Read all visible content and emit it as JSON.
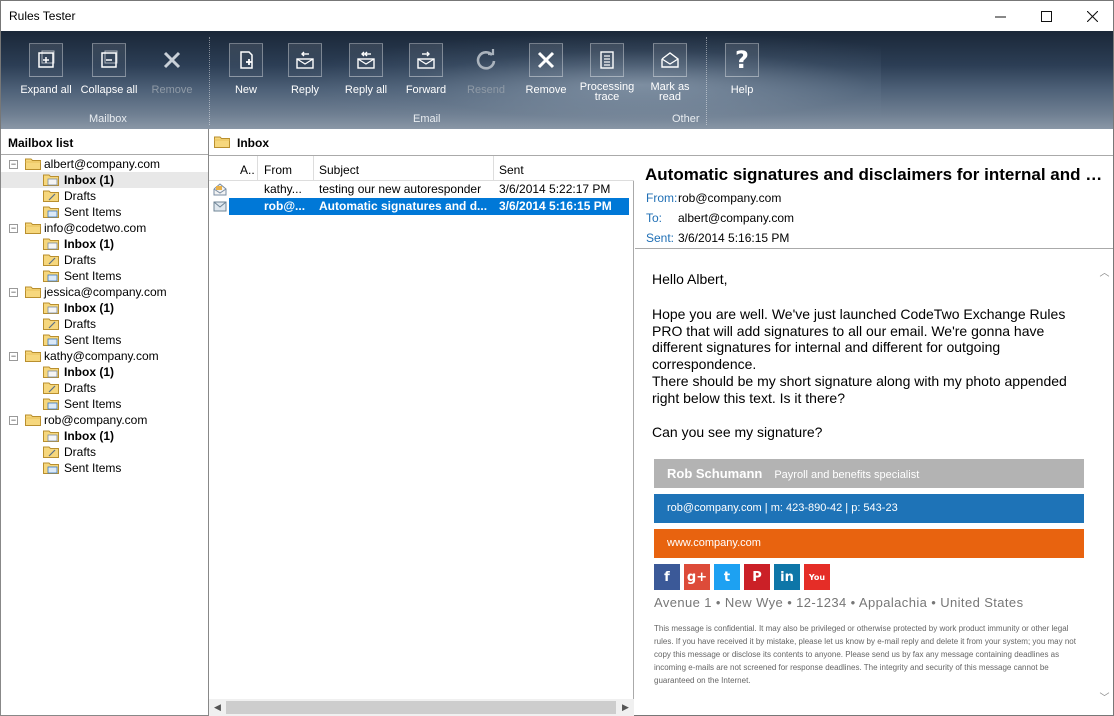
{
  "window": {
    "title": "Rules Tester"
  },
  "ribbon": {
    "groups": {
      "mailbox": "Mailbox",
      "email": "Email",
      "other": "Other"
    },
    "buttons": {
      "expand_all": "Expand all",
      "collapse_all": "Collapse all",
      "remove_mailbox": "Remove",
      "new": "New",
      "reply": "Reply",
      "reply_all": "Reply all",
      "forward": "Forward",
      "resend": "Resend",
      "remove_email": "Remove",
      "processing_trace_1": "Processing",
      "processing_trace_2": "trace",
      "mark_as_read_1": "Mark as",
      "mark_as_read_2": "read",
      "help": "Help"
    }
  },
  "mailbox_list": {
    "header": "Mailbox list",
    "accounts": [
      {
        "name": "albert@company.com",
        "inbox": "Inbox (1)",
        "drafts": "Drafts",
        "sent": "Sent Items"
      },
      {
        "name": "info@codetwo.com",
        "inbox": "Inbox (1)",
        "drafts": "Drafts",
        "sent": "Sent Items"
      },
      {
        "name": "jessica@company.com",
        "inbox": "Inbox (1)",
        "drafts": "Drafts",
        "sent": "Sent Items"
      },
      {
        "name": "kathy@company.com",
        "inbox": "Inbox (1)",
        "drafts": "Drafts",
        "sent": "Sent Items"
      },
      {
        "name": "rob@company.com",
        "inbox": "Inbox (1)",
        "drafts": "Drafts",
        "sent": "Sent Items"
      }
    ]
  },
  "folder": {
    "title": "Inbox"
  },
  "message_list": {
    "columns": {
      "attachment": "A..",
      "from": "From",
      "subject": "Subject",
      "sent": "Sent"
    },
    "rows": [
      {
        "from": "kathy...",
        "subject": "testing our new autoresponder",
        "sent": "3/6/2014 5:22:17 PM"
      },
      {
        "from": "rob@...",
        "subject": "Automatic signatures and d...",
        "sent": "3/6/2014 5:16:15 PM"
      }
    ]
  },
  "message": {
    "subject": "Automatic signatures and disclaimers for internal and o...",
    "from_label": "From:",
    "from": "rob@company.com",
    "to_label": "To:",
    "to": "albert@company.com",
    "sent_label": "Sent:",
    "sent": "3/6/2014 5:16:15 PM",
    "greeting": "Hello Albert,",
    "paragraph_1": "Hope you are well. We've just launched CodeTwo Exchange Rules PRO that will add signatures to all our email. We're gonna have different signatures for internal and different for outgoing correspondence.",
    "paragraph_2": "There should be my short signature along with my photo appended right below this text. Is it there?",
    "paragraph_3": "Can you see my signature?",
    "signature": {
      "name": "Rob Schumann",
      "role": "Payroll and benefits specialist",
      "contact": "rob@company.com |  m:  423-890-42 | p: 543-23",
      "website": "www.company.com",
      "address": "Avenue 1 • New Wye  • 12-1234 • Appalachia • United States",
      "disclaimer": "This message is confidential. It may also be privileged or otherwise protected by work product immunity or other legal rules. If you have received it by mistake, please let us know by e-mail reply and delete it from your system; you may not copy this message or disclose its contents to anyone. Please send us by fax any message containing deadlines as incoming e-mails are not screened for response deadlines. The integrity and security of this message cannot be guaranteed on the Internet."
    },
    "social_icons": [
      {
        "icon": "facebook-icon",
        "glyph": "f",
        "color": "#3b5998"
      },
      {
        "icon": "google-plus-icon",
        "glyph": "g+",
        "color": "#dd4b39"
      },
      {
        "icon": "twitter-icon",
        "glyph": "t",
        "color": "#1da1f2"
      },
      {
        "icon": "pinterest-icon",
        "glyph": "P",
        "color": "#cb2027"
      },
      {
        "icon": "linkedin-icon",
        "glyph": "in",
        "color": "#0e76a8"
      },
      {
        "icon": "youtube-icon",
        "glyph": "You",
        "color": "#e52d27"
      }
    ]
  },
  "colors": {
    "selection": "#0078d7",
    "label_blue": "#1f6fb5",
    "sig_gray": "#b3b3b3",
    "sig_blue": "#1e73b7",
    "sig_orange": "#e8630f"
  }
}
